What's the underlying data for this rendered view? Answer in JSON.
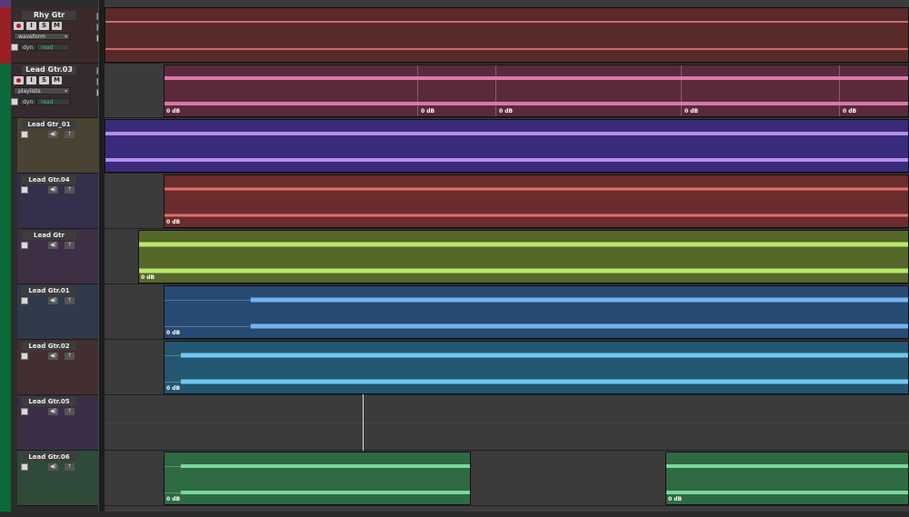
{
  "tracks": [
    {
      "name": "Rhy Gtr",
      "color": "#7a2f2f",
      "view": "waveform",
      "auto": "dyn",
      "mode": "read"
    },
    {
      "name": "Lead Gtr.03",
      "color": "#9a3b57",
      "view": "playlists",
      "auto": "dyn",
      "mode": "read"
    },
    {
      "name": "Lead Gtr_01",
      "color": "#4a2f8f"
    },
    {
      "name": "Lead Gtr.04",
      "color": "#8a3434"
    },
    {
      "name": "Lead Gtr",
      "color": "#6f8a2c"
    },
    {
      "name": "Lead Gtr.01",
      "color": "#2f5c8c"
    },
    {
      "name": "Lead Gtr.02",
      "color": "#2b5f7c"
    },
    {
      "name": "Lead Gtr.05",
      "color": "#3b3b3b"
    },
    {
      "name": "Lead Gtr.06",
      "color": "#2f7a45"
    }
  ],
  "buttons": {
    "input": "I",
    "solo": "S",
    "mute": "M"
  },
  "clip_gain": "0 dB",
  "colors": {
    "wave_pink": "#d87aa6",
    "wave_red": "#e07070",
    "wave_purple": "#b48cf0",
    "wave_lime": "#b8e86a",
    "wave_blue": "#72b4f2",
    "wave_cyan": "#6fc8f0",
    "wave_green": "#78d89a"
  }
}
